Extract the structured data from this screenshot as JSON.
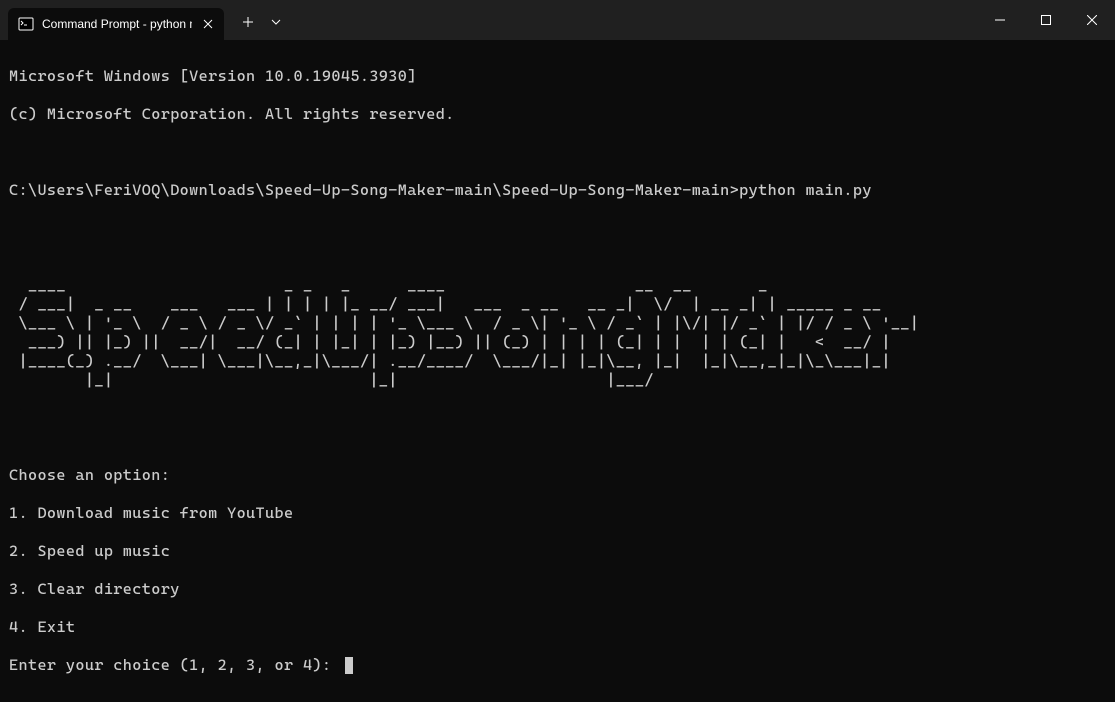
{
  "titlebar": {
    "tab_title": "Command Prompt - python  m"
  },
  "terminal": {
    "header1": "Microsoft Windows [Version 10.0.19045.3930]",
    "header2": "(c) Microsoft Corporation. All rights reserved.",
    "prompt_path": "C:\\Users\\FeriVOQ\\Downloads\\Speed-Up-Song-Maker-main\\Speed-Up-Song-Maker-main>",
    "command": "python main.py",
    "ascii_art": "  ____                       _ _   _      ____                    __  __       _             \n / ___|  _ __    ___   ___ | | | | |_ __/ ___|   ___  _ __   __ _|  \\/  | __ _| | _____ _ __ \n \\___ \\ | '_ \\  / _ \\ / _ \\/ _` | | | | '_ \\___ \\  / _ \\| '_ \\ / _` | |\\/| |/ _` | |/ / _ \\ '__|\n  ___) || |_) ||  __/|  __/ (_| | |_| | |_) |__) || (_) | | | | (_| | |  | | (_| |   <  __/ |   \n |____(_) .__/  \\___| \\___|\\__,_|\\___/| .__/____/  \\___/|_| |_|\\__, |_|  |_|\\__,_|_|\\_\\___|_|   \n        |_|                           |_|                      |___/                            ",
    "menu_title": "Choose an option:",
    "menu_items": [
      "1. Download music from YouTube",
      "2. Speed up music",
      "3. Clear directory",
      "4. Exit"
    ],
    "input_prompt": "Enter your choice (1, 2, 3, or 4): "
  }
}
